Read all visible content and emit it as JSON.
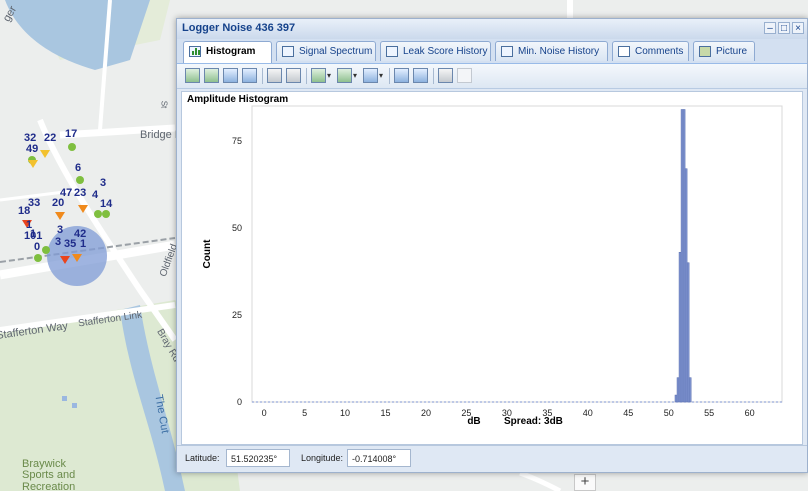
{
  "window": {
    "title": "Logger Noise 436 397",
    "controls": {
      "minimize": "–",
      "restore": "□",
      "close": "×"
    }
  },
  "tabs": [
    {
      "label": "Histogram",
      "active": true,
      "icon": "histogram-icon"
    },
    {
      "label": "Signal Spectrum",
      "icon": "signal-spectrum-icon"
    },
    {
      "label": "Leak Score History",
      "icon": "leak-score-chart-icon"
    },
    {
      "label": "Min. Noise History",
      "icon": "min-noise-chart-icon"
    },
    {
      "label": "Comments",
      "icon": "comments-icon"
    },
    {
      "label": "Picture",
      "icon": "picture-icon"
    }
  ],
  "toolbar_icons": [
    "bar-chart-icon",
    "stacked-bar-icon",
    "line-chart-icon",
    "area-chart-icon",
    "table-icon",
    "columns-icon",
    "chart-type-dropdown-icon",
    "series-dropdown-icon",
    "color-dropdown-icon",
    "export-icon",
    "grid-icon",
    "print-icon",
    "eraser-icon"
  ],
  "chart_data": {
    "type": "bar",
    "title": "Amplitude Histogram",
    "xlabel": "dB",
    "ylabel": "Count",
    "spread_label": "Spread: 3dB",
    "xlim": [
      -1.5,
      64
    ],
    "ylim": [
      0,
      85
    ],
    "xticks": [
      0,
      5,
      10,
      15,
      20,
      25,
      30,
      35,
      40,
      45,
      50,
      55,
      60
    ],
    "yticks": [
      0,
      25,
      50,
      75
    ],
    "bar_width": 0.25,
    "bars": [
      {
        "x": 50.9,
        "y": 2
      },
      {
        "x": 51.15,
        "y": 7
      },
      {
        "x": 51.4,
        "y": 43
      },
      {
        "x": 51.65,
        "y": 84
      },
      {
        "x": 51.9,
        "y": 84
      },
      {
        "x": 52.15,
        "y": 67
      },
      {
        "x": 52.4,
        "y": 40
      },
      {
        "x": 52.65,
        "y": 7
      }
    ],
    "bar_color": "#7e93cf"
  },
  "status": {
    "latitude_label": "Latitude:",
    "latitude_value": "51.520235°",
    "longitude_label": "Longitude:",
    "longitude_value": "-0.714008°"
  },
  "map": {
    "labels": {
      "bridge_rd": "Bridge R",
      "stafferton_way": "Stafferton Way",
      "stafferton_link": "Stafferton Link",
      "bray_rd": "Bray Rd",
      "oldfield": "Oldfield",
      "the_cut": "The Cut",
      "braywick": "Braywick",
      "sports_and": "Sports and",
      "recreation": "Recreation",
      "ger": "ger",
      "st": "St"
    },
    "clusters": [
      "32",
      "22",
      "17",
      "49",
      "6",
      "3",
      "47",
      "23",
      "4",
      "14",
      "33",
      "18",
      "20",
      "3",
      "42",
      "1",
      "101",
      "3",
      "35",
      "1",
      "0",
      "1"
    ],
    "zoom_plus": "+"
  }
}
